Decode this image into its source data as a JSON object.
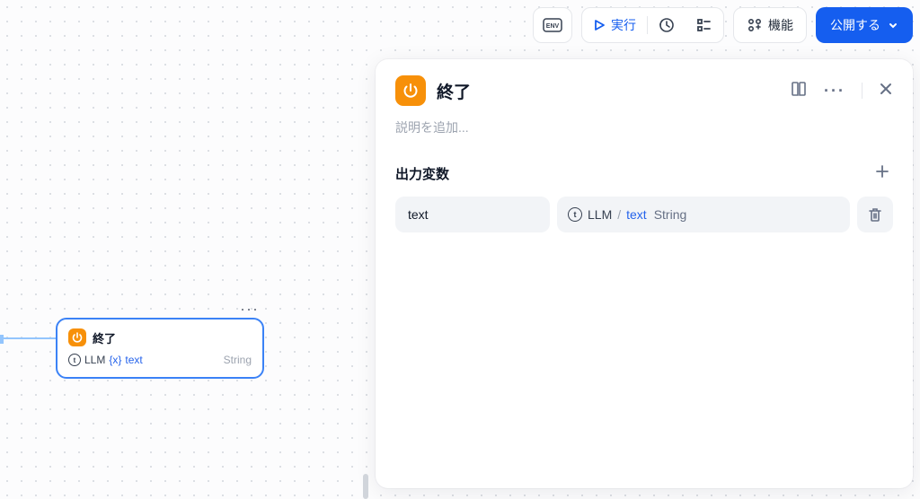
{
  "toolbar": {
    "env_label": "ENV",
    "run_label": "実行",
    "features_label": "機能",
    "publish_label": "公開する"
  },
  "node": {
    "title": "終了",
    "var_source": "LLM",
    "var_braces": "{x}",
    "var_field": "text",
    "var_type": "String"
  },
  "panel": {
    "title": "終了",
    "description_placeholder": "説明を追加...",
    "outputs_section_title": "出力変数",
    "var_name": "text",
    "var_source_node": "LLM",
    "var_source_field": "text",
    "var_source_type": "String"
  }
}
